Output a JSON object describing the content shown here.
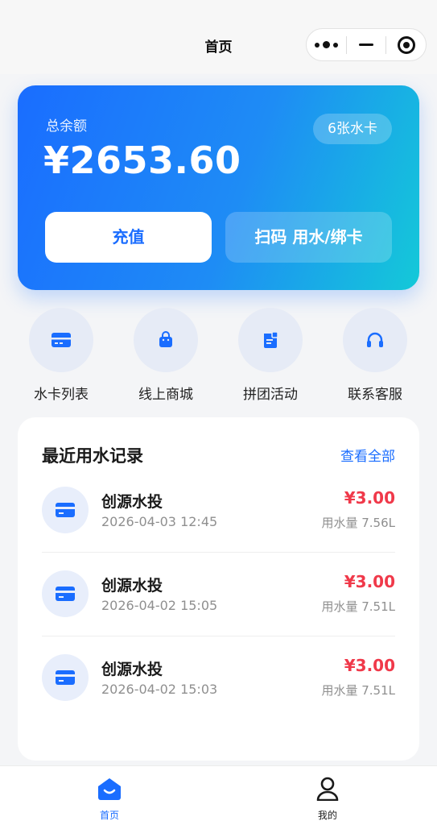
{
  "nav": {
    "title": "首页"
  },
  "balance": {
    "label": "总余额",
    "amount": "¥2653.60",
    "cards_badge": "6张水卡",
    "recharge_label": "充值",
    "scan_label": "扫码 用水/绑卡"
  },
  "quick_actions": [
    {
      "label": "水卡列表",
      "icon": "card-icon"
    },
    {
      "label": "线上商城",
      "icon": "shopping-bag-icon"
    },
    {
      "label": "拼团活动",
      "icon": "activity-icon"
    },
    {
      "label": "联系客服",
      "icon": "headset-icon"
    }
  ],
  "records": {
    "title": "最近用水记录",
    "view_all": "查看全部",
    "items": [
      {
        "name": "创源水投",
        "time": "2026-04-03 12:45",
        "price": "¥3.00",
        "usage": "用水量 7.56L"
      },
      {
        "name": "创源水投",
        "time": "2026-04-02 15:05",
        "price": "¥3.00",
        "usage": "用水量 7.51L"
      },
      {
        "name": "创源水投",
        "time": "2026-04-02 15:03",
        "price": "¥3.00",
        "usage": "用水量 7.51L"
      }
    ]
  },
  "tabbar": {
    "home_label": "首页",
    "mine_label": "我的",
    "active_color": "#1a6dff",
    "inactive_color": "#1a1a1a"
  },
  "colors": {
    "accent": "#1a6dff",
    "price": "#f0394a",
    "gradient_start": "#1a6dff",
    "gradient_end": "#14c9d8"
  }
}
